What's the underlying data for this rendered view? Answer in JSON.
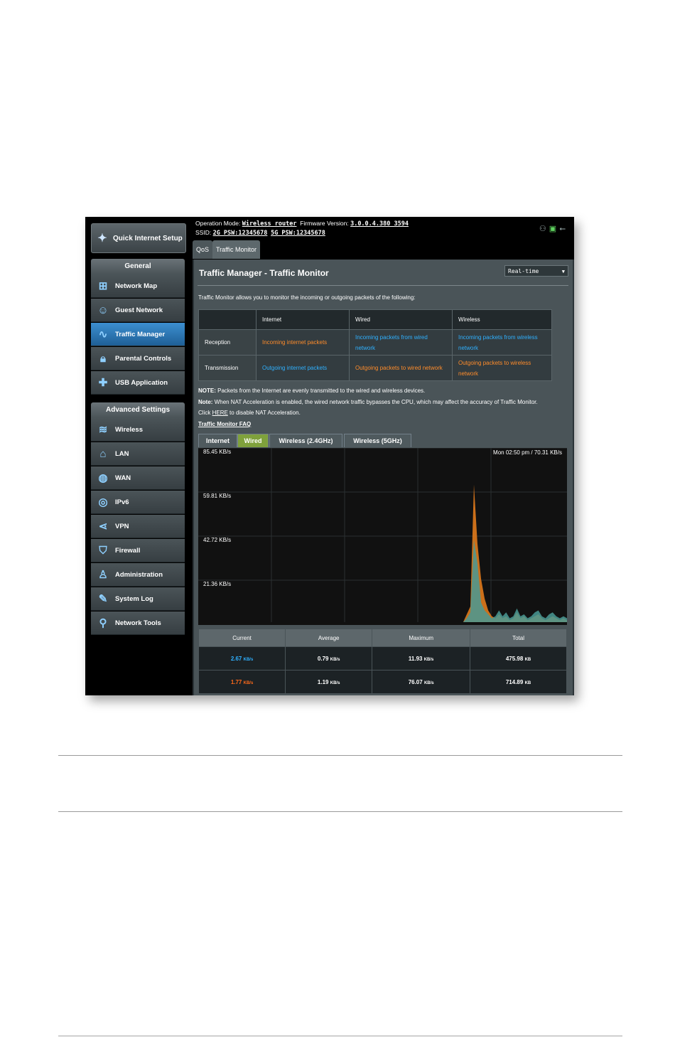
{
  "sidebar": {
    "quick_setup": "Quick Internet Setup",
    "general_title": "General",
    "general_items": [
      {
        "label": "Network Map",
        "icon": "network-map-icon"
      },
      {
        "label": "Guest Network",
        "icon": "guest-network-icon"
      },
      {
        "label": "Traffic Manager",
        "icon": "traffic-manager-icon",
        "active": true
      },
      {
        "label": "Parental Controls",
        "icon": "lock-icon"
      },
      {
        "label": "USB Application",
        "icon": "puzzle-icon"
      }
    ],
    "advanced_title": "Advanced Settings",
    "advanced_items": [
      {
        "label": "Wireless",
        "icon": "wifi-icon"
      },
      {
        "label": "LAN",
        "icon": "home-icon"
      },
      {
        "label": "WAN",
        "icon": "globe-icon"
      },
      {
        "label": "IPv6",
        "icon": "ipv6-icon"
      },
      {
        "label": "VPN",
        "icon": "vpn-icon"
      },
      {
        "label": "Firewall",
        "icon": "shield-icon"
      },
      {
        "label": "Administration",
        "icon": "user-icon"
      },
      {
        "label": "System Log",
        "icon": "log-icon"
      },
      {
        "label": "Network Tools",
        "icon": "tools-icon"
      }
    ]
  },
  "topbar": {
    "op_mode_label": "Operation Mode:",
    "op_mode_value": "Wireless router",
    "fw_label": "Firmware Version:",
    "fw_value": "3.0.0.4.380_3594",
    "ssid_label": "SSID:",
    "ssid_2g": "2G_PSW:12345678",
    "ssid_5g": "5G_PSW:12345678"
  },
  "tabs": [
    "QoS",
    "Traffic Monitor"
  ],
  "page": {
    "title": "Traffic Manager - Traffic Monitor",
    "select_value": "Real-time",
    "description": "Traffic Monitor allows you to monitor the incoming or outgoing packets of the following:"
  },
  "packet_table": {
    "headers": [
      "",
      "Internet",
      "Wired",
      "Wireless"
    ],
    "rows": [
      {
        "label": "Reception",
        "internet": "Incoming internet packets",
        "wired": "Incoming packets from wired network",
        "wireless": "Incoming packets from wireless network"
      },
      {
        "label": "Transmission",
        "internet": "Outgoing internet packets",
        "wired": "Outgoing packets to wired network",
        "wireless": "Outgoing packets to wireless network"
      }
    ]
  },
  "notes": {
    "note1_label": "NOTE:",
    "note1_text": "Packets from the Internet are evenly transmitted to the wired and wireless devices.",
    "note2_label": "Note:",
    "note2_text": "When NAT Acceleration is enabled, the wired network traffic bypasses the CPU, which may affect the accuracy of Traffic Monitor.",
    "note3_pre": "Click",
    "note3_link": "HERE",
    "note3_post": "to disable NAT Acceleration.",
    "faq": "Traffic Monitor FAQ"
  },
  "chart_tabs": [
    "Internet",
    "Wired",
    "Wireless (2.4GHz)",
    "Wireless (5GHz)"
  ],
  "chart_data": {
    "type": "area",
    "y_tick_labels": [
      "85.45 KB/s",
      "59.81 KB/s",
      "42.72 KB/s",
      "21.36 KB/s"
    ],
    "readout": "Mon 02:50 pm / 70.31 KB/s",
    "ylim": [
      0,
      85.45
    ],
    "series": [
      {
        "color": "#e07a1c",
        "values": [
          0,
          0,
          0,
          0,
          0,
          0,
          0,
          0,
          0,
          0,
          0,
          0,
          0,
          0,
          0,
          0,
          0,
          0,
          0,
          0,
          0,
          0,
          0,
          0,
          0,
          0,
          0,
          0,
          0,
          0,
          0,
          0,
          0,
          0,
          0,
          0,
          0,
          0,
          0,
          0,
          0,
          0,
          0,
          0,
          0,
          0,
          0,
          0,
          0,
          0,
          0,
          0,
          0,
          0,
          0,
          0,
          0,
          0,
          0,
          0,
          0,
          0,
          0,
          0,
          0,
          0,
          0,
          0,
          0,
          0,
          0,
          0,
          0,
          0,
          0,
          4,
          8,
          70.31,
          40,
          22,
          12,
          6,
          3,
          2,
          4,
          2,
          3,
          1,
          2,
          5,
          2,
          3,
          1,
          2,
          3,
          4,
          2,
          1,
          2,
          3,
          2,
          1,
          2,
          1
        ]
      },
      {
        "color": "#4a9a95",
        "values": [
          0,
          0,
          0,
          0,
          0,
          0,
          0,
          0,
          0,
          0,
          0,
          0,
          0,
          0,
          0,
          0,
          0,
          0,
          0,
          0,
          0,
          0,
          0,
          0,
          0,
          0,
          0,
          0,
          0,
          0,
          0,
          0,
          0,
          0,
          0,
          0,
          0,
          0,
          0,
          0,
          0,
          0,
          0,
          0,
          0,
          0,
          0,
          0,
          0,
          0,
          0,
          0,
          0,
          0,
          0,
          0,
          0,
          0,
          0,
          0,
          0,
          0,
          0,
          0,
          0,
          0,
          0,
          0,
          0,
          0,
          0,
          0,
          0,
          0,
          0,
          2,
          5,
          42,
          30,
          10,
          6,
          4,
          2,
          3,
          6,
          3,
          5,
          2,
          3,
          7,
          3,
          4,
          2,
          3,
          5,
          6,
          3,
          2,
          4,
          5,
          3,
          2,
          3,
          2
        ]
      }
    ]
  },
  "stats": {
    "headers": [
      "Current",
      "Average",
      "Maximum",
      "Total"
    ],
    "rows": [
      {
        "current": "2.67",
        "current_unit": "KB/s",
        "average": "0.79",
        "average_unit": "KB/s",
        "maximum": "11.93",
        "maximum_unit": "KB/s",
        "total": "475.98",
        "total_unit": "KB",
        "color": "#2fb1ff"
      },
      {
        "current": "1.77",
        "current_unit": "KB/s",
        "average": "1.19",
        "average_unit": "KB/s",
        "maximum": "76.07",
        "maximum_unit": "KB/s",
        "total": "714.89",
        "total_unit": "KB",
        "color": "#ff6a1a"
      }
    ]
  }
}
